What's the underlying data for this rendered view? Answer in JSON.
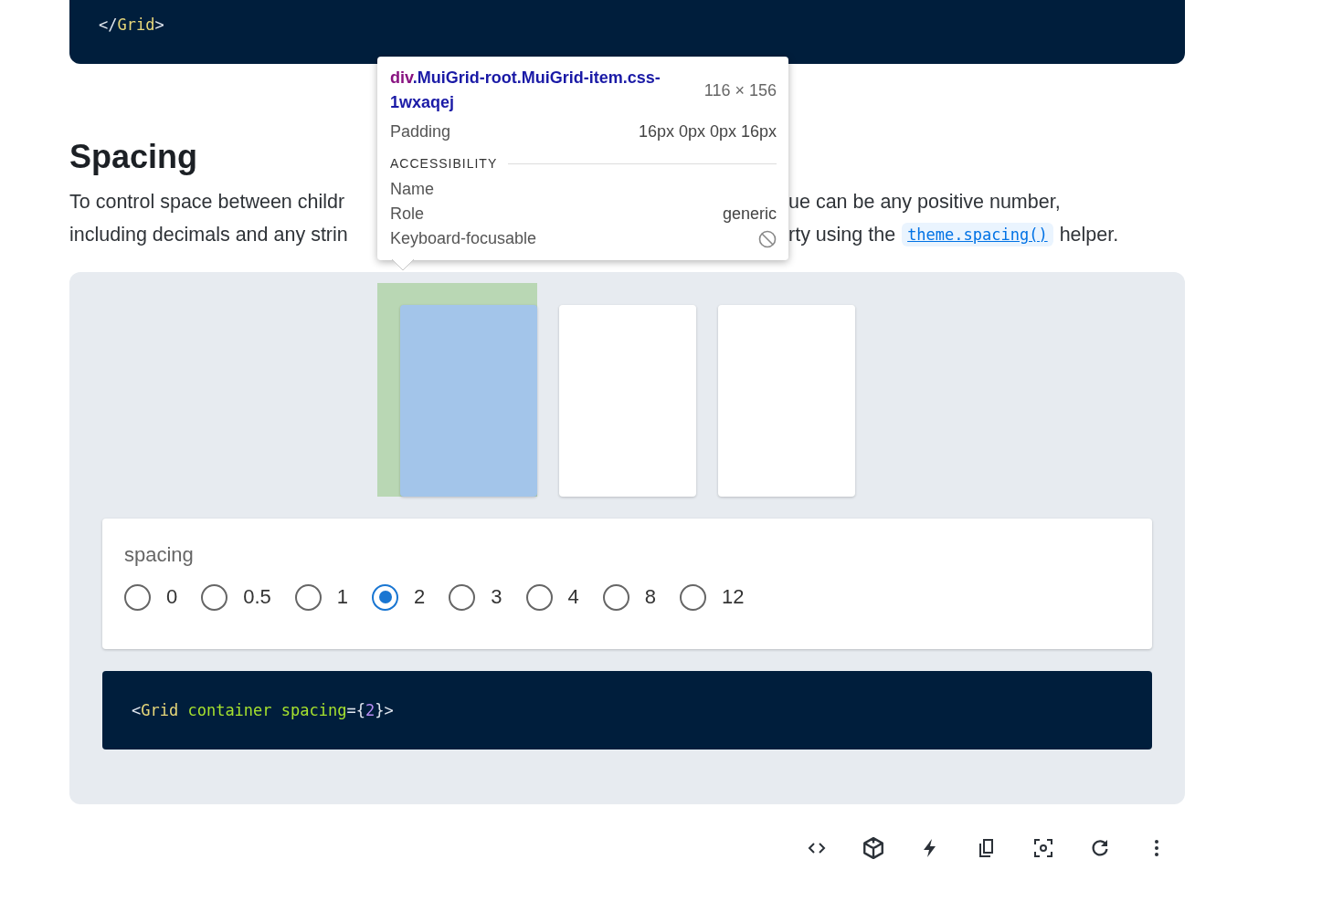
{
  "code_top": {
    "lines": [
      [
        {
          "kind": "punct",
          "text": "</"
        },
        {
          "kind": "tag",
          "text": "Grid"
        },
        {
          "kind": "punct",
          "text": ">"
        }
      ]
    ]
  },
  "section": {
    "heading": "Spacing",
    "lines": [
      {
        "left": "To control space between childr",
        "right": [
          {
            "kind": "text",
            "text": "ue can be any positive number,"
          }
        ]
      },
      {
        "left": "including decimals and any strin",
        "right": [
          {
            "kind": "text",
            "text": "rty using the"
          },
          {
            "kind": "code_link",
            "text": "theme.spacing()"
          },
          {
            "kind": "text",
            "text": "helper."
          }
        ]
      }
    ]
  },
  "demo": {
    "items": [
      {
        "highlighted": true
      },
      {
        "highlighted": false
      },
      {
        "highlighted": false
      }
    ],
    "controls": {
      "label": "spacing",
      "options": [
        {
          "label": "0",
          "selected": false
        },
        {
          "label": "0.5",
          "selected": false
        },
        {
          "label": "1",
          "selected": false
        },
        {
          "label": "2",
          "selected": true
        },
        {
          "label": "3",
          "selected": false
        },
        {
          "label": "4",
          "selected": false
        },
        {
          "label": "8",
          "selected": false
        },
        {
          "label": "12",
          "selected": false
        }
      ]
    },
    "code": [
      {
        "kind": "punct",
        "text": "<"
      },
      {
        "kind": "tag",
        "text": "Grid"
      },
      {
        "kind": "attr",
        "text": " container spacing"
      },
      {
        "kind": "punct",
        "text": "={"
      },
      {
        "kind": "number",
        "text": "2"
      },
      {
        "kind": "punct",
        "text": "}>"
      }
    ]
  },
  "tooltip": {
    "element_tag": "div",
    "element_classes": ".MuiGrid-root.MuiGrid-item.css-1wxaqej",
    "size": "116 × 156",
    "rows": [
      {
        "label": "Padding",
        "kind": "text",
        "value": "16px 0px 0px 16px"
      }
    ],
    "section_title": "ACCESSIBILITY",
    "section_rows": [
      {
        "label": "Name",
        "kind": "empty"
      },
      {
        "label": "Role",
        "kind": "text",
        "value": "generic"
      },
      {
        "label": "Keyboard-focusable",
        "kind": "blocked"
      }
    ]
  },
  "toolbar": [
    {
      "kind": "code"
    },
    {
      "kind": "cube"
    },
    {
      "kind": "bolt"
    },
    {
      "kind": "copy"
    },
    {
      "kind": "screenshot"
    },
    {
      "kind": "reload"
    },
    {
      "kind": "more"
    }
  ]
}
